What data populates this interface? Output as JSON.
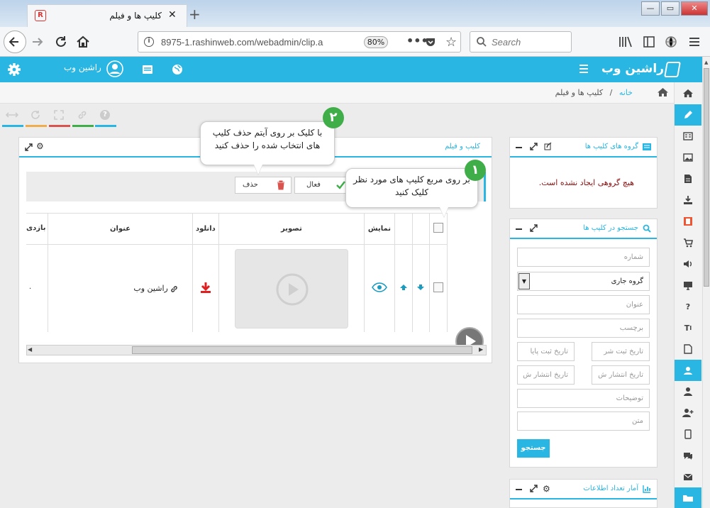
{
  "browser": {
    "tab_title": "کلیپ ها و فیلم",
    "url": "8975-1.rashinweb.com/webadmin/clip.a",
    "zoom": "80%",
    "search_placeholder": "Search"
  },
  "header": {
    "username": "راشین وب",
    "logo": "راشین وب"
  },
  "breadcrumb": {
    "home": "خانه",
    "separator": "/",
    "current": "کلیپ ها و فیلم"
  },
  "toolbar": {
    "colors": [
      "#29b6e3",
      "#f0ad4e",
      "#d9534f",
      "#3fae49",
      "#29b6e3"
    ]
  },
  "clip_groups": {
    "title": "گروه های کلیپ ها",
    "empty_message": "هیچ گروهی ایجاد نشده است."
  },
  "search_panel": {
    "title": "جستجو در کلیپ ها",
    "number_placeholder": "شماره",
    "group_value": "گروه جاری",
    "title_placeholder": "عنوان",
    "tag_placeholder": "برچسب",
    "reg_date_from": "تاریخ ثبت شر",
    "reg_date_to": "تاریخ ثبت پایا",
    "pub_date_from": "تاریخ انتشار ش",
    "pub_date_to": "تاریخ انتشار ش",
    "description_placeholder": "توضیحات",
    "text_placeholder": "متن",
    "search_button": "جستجو"
  },
  "stats_panel": {
    "title": "آمار تعداد اطلاعات"
  },
  "main": {
    "title": "کلیپ و فیلم",
    "actions": {
      "delete": "حذف",
      "active": "فعال"
    },
    "table": {
      "headers": [
        "نمایش",
        "تصویر",
        "دانلود",
        "عنوان",
        "بازدی"
      ],
      "row": {
        "title": "راشین وب",
        "views": "۰"
      }
    }
  },
  "tips": {
    "one": {
      "number": "۱",
      "text": "بر روی مربع کلیپ های مورد نظر کلیک کنید"
    },
    "two": {
      "number": "۲",
      "text": "با کلیک بر روی آیتم حذف کلیپ های انتخاب شده را حذف کنید"
    }
  },
  "colors": {
    "accent": "#29b6e3",
    "badge": "#3fae49",
    "danger": "#d9534f",
    "download": "#e02020"
  }
}
